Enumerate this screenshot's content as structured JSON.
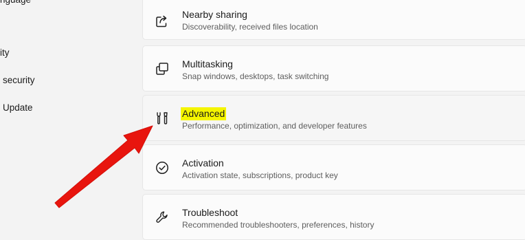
{
  "sidebar": {
    "items": [
      {
        "label": "nguage"
      },
      {
        "label": "ity"
      },
      {
        "label": "security"
      },
      {
        "label": "Update"
      }
    ]
  },
  "cards": [
    {
      "title": "Nearby sharing",
      "subtitle": "Discoverability, received files location",
      "icon": "share-icon"
    },
    {
      "title": "Multitasking",
      "subtitle": "Snap windows, desktops, task switching",
      "icon": "multitasking-icon"
    },
    {
      "title": "Advanced",
      "subtitle": "Performance, optimization, and developer features",
      "icon": "tools-icon",
      "highlighted": true
    },
    {
      "title": "Activation",
      "subtitle": "Activation state, subscriptions, product key",
      "icon": "check-circle-icon"
    },
    {
      "title": "Troubleshoot",
      "subtitle": "Recommended troubleshooters, preferences, history",
      "icon": "wrench-icon"
    }
  ],
  "colors": {
    "highlight": "#f5f500",
    "arrow": "#e8150e"
  }
}
